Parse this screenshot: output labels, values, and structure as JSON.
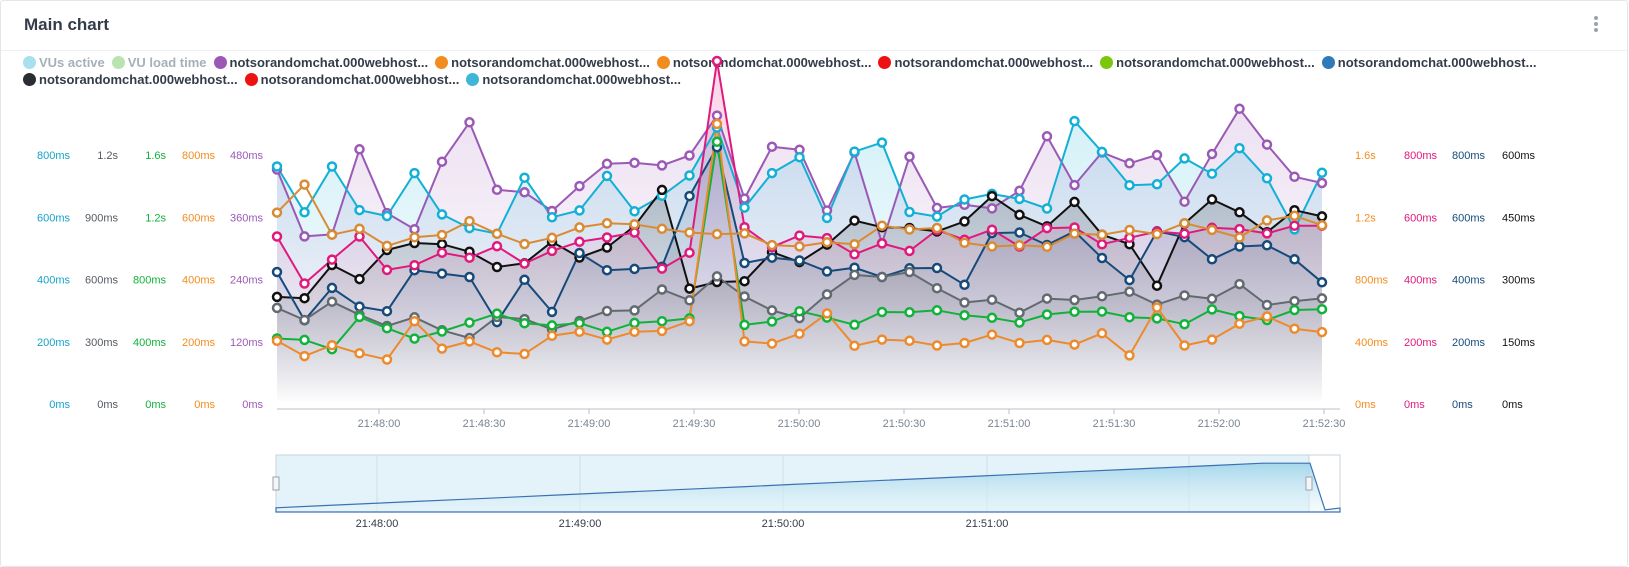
{
  "panel": {
    "title": "Main chart"
  },
  "legend": [
    {
      "label": "VUs active",
      "color": "#a9dfee",
      "off": true
    },
    {
      "label": "VU load time",
      "color": "#b9e3b0",
      "off": true
    },
    {
      "label": "notsorandomchat.000webhost...",
      "color": "#9b59b6"
    },
    {
      "label": "notsorandomchat.000webhost...",
      "color": "#f28c1e"
    },
    {
      "label": "notsorandomchat.000webhost...",
      "color": "#f28c1e"
    },
    {
      "label": "notsorandomchat.000webhost...",
      "color": "#ee1111"
    },
    {
      "label": "notsorandomchat.000webhost...",
      "color": "#7ac70c"
    },
    {
      "label": "notsorandomchat.000webhost...",
      "color": "#2e7bb8"
    },
    {
      "label": "notsorandomchat.000webhost...",
      "color": "#2a2e33"
    },
    {
      "label": "notsorandomchat.000webhost...",
      "color": "#ee1111"
    },
    {
      "label": "notsorandomchat.000webhost...",
      "color": "#3fb6d8"
    }
  ],
  "chart_data": {
    "type": "line",
    "x": [
      "21:47:45",
      "21:47:52",
      "21:47:60",
      "21:48:07",
      "21:48:15",
      "21:48:22",
      "21:48:30",
      "21:48:37",
      "21:48:45",
      "21:48:52",
      "21:49:00",
      "21:49:07",
      "21:49:15",
      "21:49:22",
      "21:49:30",
      "21:49:37",
      "21:49:45",
      "21:49:52",
      "21:50:00",
      "21:50:07",
      "21:50:15",
      "21:50:22",
      "21:50:30",
      "21:50:37",
      "21:50:45",
      "21:50:52",
      "21:51:00",
      "21:51:07",
      "21:51:15",
      "21:51:22",
      "21:51:30",
      "21:51:37",
      "21:51:45",
      "21:51:52",
      "21:52:00",
      "21:52:07",
      "21:52:15",
      "21:52:22",
      "21:52:30"
    ],
    "x_ticks": [
      "21:48:00",
      "21:48:30",
      "21:49:00",
      "21:49:30",
      "21:50:00",
      "21:50:30",
      "21:51:00",
      "21:51:30",
      "21:52:00",
      "21:52:30"
    ],
    "axes": {
      "left": [
        {
          "id": "a_cyan",
          "color": "#17a2c8",
          "ticks": [
            "0ms",
            "200ms",
            "400ms",
            "600ms",
            "800ms"
          ],
          "max": 1000
        },
        {
          "id": "a_gray",
          "color": "#555b61",
          "ticks": [
            "0ms",
            "300ms",
            "600ms",
            "900ms",
            "1.2s"
          ],
          "max": 1500
        },
        {
          "id": "a_green",
          "color": "#11b23a",
          "ticks": [
            "0ms",
            "400ms",
            "800ms",
            "1.2s",
            "1.6s"
          ],
          "max": 2000
        },
        {
          "id": "a_orange",
          "color": "#f28c1e",
          "ticks": [
            "0ms",
            "200ms",
            "400ms",
            "600ms",
            "800ms"
          ],
          "max": 1000
        },
        {
          "id": "a_purple",
          "color": "#9b59b6",
          "ticks": [
            "0ms",
            "120ms",
            "240ms",
            "360ms",
            "480ms"
          ],
          "max": 600
        }
      ],
      "right": [
        {
          "id": "a_orange2",
          "color": "#f28c1e",
          "ticks": [
            "0ms",
            "400ms",
            "800ms",
            "1.2s",
            "1.6s"
          ],
          "max": 2000
        },
        {
          "id": "a_pink",
          "color": "#e0197d",
          "ticks": [
            "0ms",
            "200ms",
            "400ms",
            "600ms",
            "800ms"
          ],
          "max": 1000
        },
        {
          "id": "a_navy",
          "color": "#164a7a",
          "ticks": [
            "0ms",
            "200ms",
            "400ms",
            "600ms",
            "800ms"
          ],
          "max": 1000
        },
        {
          "id": "a_black",
          "color": "#111111",
          "ticks": [
            "0ms",
            "150ms",
            "300ms",
            "450ms",
            "600ms"
          ],
          "max": 750
        }
      ]
    },
    "series": [
      {
        "axis": "a_purple",
        "color": "#9b59b6",
        "fill": true,
        "values": [
          452,
          323,
          327,
          491,
          368,
          337,
          467,
          543,
          413,
          408,
          372,
          420,
          463,
          465,
          460,
          479,
          556,
          396,
          496,
          490,
          373,
          485,
          310,
          477,
          378,
          384,
          377,
          411,
          516,
          422,
          485,
          464,
          480,
          390,
          482,
          569,
          500,
          438,
          426
        ]
      },
      {
        "axis": "a_cyan",
        "color": "#13b0d6",
        "fill": true,
        "values": [
          763,
          616,
          763,
          623,
          604,
          742,
          609,
          565,
          547,
          727,
          600,
          622,
          733,
          619,
          669,
          734,
          888,
          631,
          742,
          793,
          598,
          811,
          840,
          617,
          602,
          657,
          675,
          659,
          628,
          909,
          810,
          703,
          706,
          789,
          740,
          822,
          725,
          561,
          743
        ]
      },
      {
        "axis": "a_black",
        "color": "#111111",
        "fill": true,
        "values": [
          258,
          255,
          335,
          301,
          371,
          388,
          385,
          367,
          330,
          339,
          391,
          353,
          377,
          429,
          516,
          278,
          294,
          296,
          366,
          342,
          384,
          442,
          426,
          424,
          416,
          440,
          501,
          456,
          428,
          487,
          408,
          385,
          285,
          435,
          493,
          462,
          414,
          467,
          452
        ]
      },
      {
        "axis": "a_navy",
        "color": "#164a7a",
        "fill": true,
        "values": [
          424,
          269,
          373,
          313,
          298,
          430,
          419,
          408,
          263,
          399,
          296,
          485,
          430,
          434,
          441,
          668,
          825,
          453,
          470,
          461,
          426,
          438,
          408,
          436,
          437,
          383,
          549,
          551,
          511,
          555,
          469,
          398,
          555,
          536,
          465,
          506,
          510,
          465,
          391
        ]
      },
      {
        "axis": "a_gray",
        "color": "#626a70",
        "fill": true,
        "values": [
          463,
          405,
          493,
          430,
          376,
          418,
          355,
          318,
          420,
          409,
          360,
          400,
          448,
          451,
          552,
          500,
          615,
          518,
          451,
          414,
          528,
          622,
          612,
          636,
          558,
          489,
          502,
          440,
          508,
          501,
          519,
          541,
          479,
          523,
          507,
          578,
          477,
          496,
          509
        ]
      },
      {
        "axis": "a_pink",
        "color": "#e0197d",
        "fill": true,
        "values": [
          538,
          387,
          464,
          538,
          431,
          446,
          486,
          470,
          507,
          451,
          492,
          521,
          535,
          551,
          435,
          486,
          1102,
          568,
          504,
          541,
          533,
          481,
          516,
          492,
          559,
          528,
          560,
          506,
          565,
          567,
          513,
          534,
          554,
          547,
          566,
          562,
          548,
          573,
          573
        ]
      },
      {
        "axis": "a_green",
        "color": "#11b23a",
        "fill": false,
        "values": [
          421,
          412,
          352,
          560,
          487,
          420,
          466,
          523,
          581,
          519,
          505,
          520,
          464,
          521,
          532,
          550,
          1685,
          508,
          530,
          596,
          555,
          509,
          591,
          589,
          602,
          570,
          554,
          523,
          575,
          593,
          594,
          558,
          550,
          513,
          608,
          565,
          540,
          604,
          609
        ]
      },
      {
        "axis": "a_orange",
        "color": "#ed8a2c",
        "fill": false,
        "values": [
          203,
          154,
          189,
          163,
          143,
          266,
          178,
          201,
          166,
          161,
          219,
          232,
          207,
          232,
          235,
          266,
          900,
          201,
          194,
          226,
          291,
          187,
          207,
          203,
          188,
          196,
          223,
          196,
          206,
          191,
          227,
          156,
          310,
          188,
          207,
          258,
          281,
          242,
          231
        ]
      },
      {
        "axis": "a_orange2",
        "color": "#d98b33",
        "fill": false,
        "values": [
          1230,
          1410,
          1088,
          1126,
          1016,
          1071,
          1086,
          1175,
          1094,
          1028,
          1068,
          1135,
          1161,
          1155,
          1126,
          1102,
          1092,
          1096,
          1021,
          1013,
          1040,
          1026,
          1146,
          1121,
          1131,
          1036,
          1012,
          1020,
          1010,
          1095,
          1087,
          1118,
          1092,
          1162,
          1119,
          1070,
          1180,
          1209,
          1148
        ]
      }
    ],
    "navigator": {
      "ticks": [
        "21:48:00",
        "21:49:00",
        "21:50:00",
        "21:51:00"
      ],
      "values": [
        2,
        3,
        4,
        5,
        6,
        7,
        8,
        9,
        10,
        11,
        12,
        13,
        14,
        15,
        16,
        17,
        18,
        19,
        20,
        21,
        22,
        23,
        23,
        1
      ]
    }
  }
}
